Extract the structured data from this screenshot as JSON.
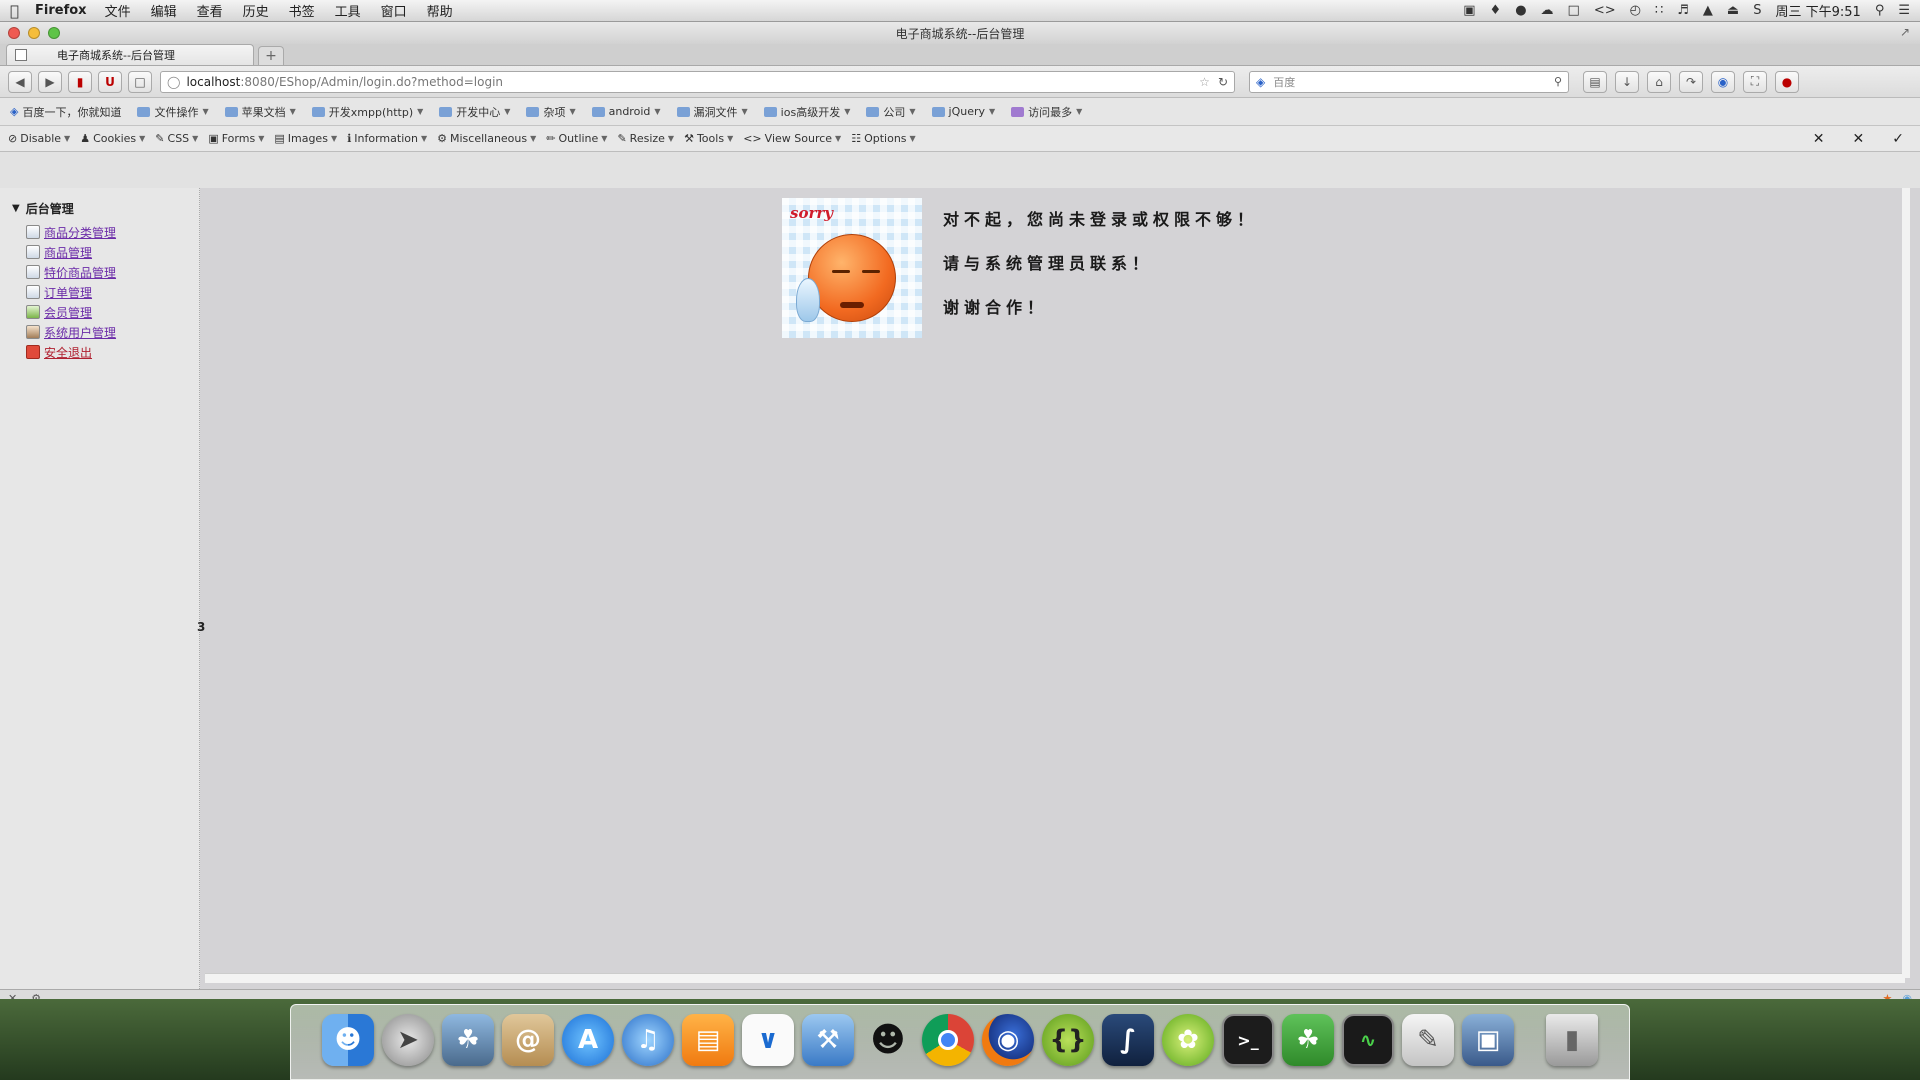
{
  "menubar": {
    "app_name": "Firefox",
    "items": [
      "文件",
      "编辑",
      "查看",
      "历史",
      "书签",
      "工具",
      "窗口",
      "帮助"
    ],
    "clock": "周三 下午9:51"
  },
  "window": {
    "title": "电子商城系统--后台管理",
    "tab_title": "电子商城系统--后台管理",
    "new_tab": "+"
  },
  "navbar": {
    "url_host": "localhost",
    "url_path": ":8080/EShop/Admin/login.do?method=login",
    "search_placeholder": "百度"
  },
  "bookmarks": [
    "百度一下，你就知道",
    "文件操作",
    "苹果文档",
    "开发xmpp(http)",
    "开发中心",
    "杂项",
    "android",
    "漏洞文件",
    "ios高级开发",
    "公司",
    "jQuery",
    "访问最多"
  ],
  "webdev_toolbar": [
    "Disable",
    "Cookies",
    "CSS",
    "Forms",
    "Images",
    "Information",
    "Miscellaneous",
    "Outline",
    "Resize",
    "Tools",
    "View Source",
    "Options"
  ],
  "sidebar": {
    "root": "后台管理",
    "items": [
      {
        "label": "商品分类管理"
      },
      {
        "label": "商品管理"
      },
      {
        "label": "特价商品管理"
      },
      {
        "label": "订单管理"
      },
      {
        "label": "会员管理"
      },
      {
        "label": "系统用户管理"
      },
      {
        "label": "安全退出"
      }
    ]
  },
  "page_marker": "3",
  "main": {
    "sorry_label": "sorry",
    "lines": [
      "对不起，您尚未登录或权限不够！",
      "请与系统管理员联系！",
      "谢谢合作！"
    ]
  },
  "dock": {
    "icons": [
      "finder-icon",
      "launchpad-icon",
      "preview-icon",
      "contacts-icon",
      "app-store-icon",
      "itunes-icon",
      "ibooks-icon",
      "instruments-icon",
      "xcode-icon",
      "qq-icon",
      "chrome-icon",
      "firefox-icon",
      "brackets-icon",
      "sublime-icon",
      "lime-icon",
      "terminal-icon",
      "evernote-icon",
      "activity-monitor-icon",
      "script-editor-icon",
      "image-capture-icon",
      "trash-icon"
    ]
  }
}
